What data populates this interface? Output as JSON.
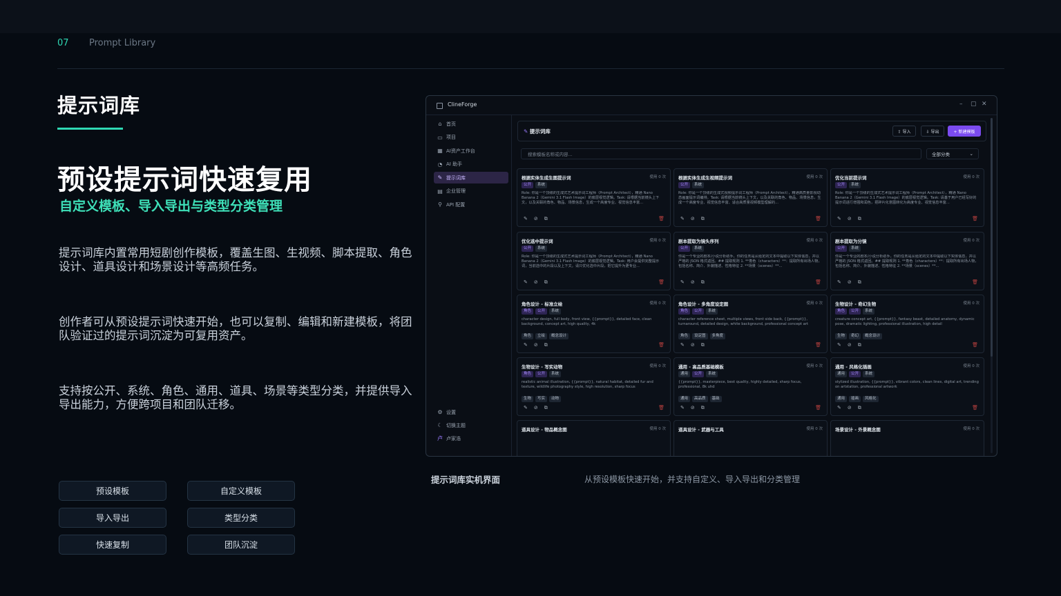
{
  "header": {
    "page_number": "07",
    "section_name": "Prompt Library"
  },
  "hero": {
    "title": "提示词库",
    "headline": "预设提示词快速复用",
    "subheadline": "自定义模板、导入导出与类型分类管理",
    "paragraphs": [
      "提示词库内置常用短剧创作模板，覆盖生图、生视频、脚本提取、角色设计、道具设计和场景设计等高频任务。",
      "创作者可从预设提示词快速开始，也可以复制、编辑和新建模板，将团队验证过的提示词沉淀为可复用资产。",
      "支持按公开、系统、角色、通用、道具、场景等类型分类，并提供导入导出能力，方便跨项目和团队迁移。"
    ]
  },
  "feature_chips": [
    "预设模板",
    "自定义模板",
    "导入导出",
    "类型分类",
    "快速复制",
    "团队沉淀"
  ],
  "captions": {
    "left": "提示词库实机界面",
    "right": "从预设模板快速开始，并支持自定义、导入导出和分类管理"
  },
  "colors": {
    "accent": "#2fd9b4",
    "brand_purple": "#7b4bf0",
    "background": "#060b12"
  },
  "app": {
    "window_title": "ClineForge",
    "window_controls": [
      "–",
      "▢",
      "✕"
    ],
    "sidebar": {
      "items": [
        {
          "label": "首页",
          "icon": "⌂",
          "icon_name": "home-icon",
          "active": false
        },
        {
          "label": "项目",
          "icon": "▭",
          "icon_name": "folder-icon",
          "active": false
        },
        {
          "label": "AI资产工作台",
          "icon": "▦",
          "icon_name": "asset-icon",
          "active": false
        },
        {
          "label": "AI 助手",
          "icon": "◔",
          "icon_name": "assistant-icon",
          "active": false
        },
        {
          "label": "提示词库",
          "icon": "✎",
          "icon_name": "prompt-library-icon",
          "active": true
        },
        {
          "label": "企业管理",
          "icon": "▤",
          "icon_name": "enterprise-icon",
          "active": false
        },
        {
          "label": "API 配置",
          "icon": "⚲",
          "icon_name": "api-icon",
          "active": false
        }
      ],
      "bottom": [
        {
          "label": "设置",
          "icon": "⚙",
          "icon_name": "gear-icon"
        },
        {
          "label": "切换主题",
          "icon": "☾",
          "icon_name": "theme-icon"
        },
        {
          "label": "卢家浩",
          "icon": "卢",
          "icon_name": "avatar"
        }
      ]
    },
    "panel_title": "提示词库",
    "buttons": {
      "import": "⇪ 导入",
      "export": "⇩ 导出",
      "new_template": "+ 新建模板"
    },
    "search_placeholder": "搜索模板名称或内容...",
    "category_select": "全部分类",
    "cards": [
      {
        "title": "根据实体生成生图提示词",
        "usage": "使用 0 次",
        "tags": [
          {
            "t": "公开",
            "c": "purple"
          },
          {
            "t": "系统",
            "c": "gray"
          }
        ],
        "desc": "Role: 你是一个顶级的生成式艺术提示词工程师（Prompt Architect），精通 Nano Banana 2（Gemini 3.1 Flash Image）的底层视觉逻辑。Task: 请根据当前镜头上下文，以及关联的角色、物品、场景信息，生成一个高度专业、视觉信息丰富...",
        "keywords": []
      },
      {
        "title": "根据实体生成生视频提示词",
        "usage": "使用 0 次",
        "tags": [
          {
            "t": "公开",
            "c": "purple"
          },
          {
            "t": "系统",
            "c": "gray"
          }
        ],
        "desc": "Role: 你是一个顶级的生成式视频提示词工程师（Prompt Architect），精通高质量影视动态画面提示词编排。Task: 请根据当前镜头上下文，以及关联的角色、物品、场景信息，生成一个高度专业、视觉信息丰富、适合高质量视频模型理解的...",
        "keywords": []
      },
      {
        "title": "优化当前提示词",
        "usage": "使用 0 次",
        "tags": [
          {
            "t": "公开",
            "c": "purple"
          },
          {
            "t": "系统",
            "c": "gray"
          }
        ],
        "desc": "Role: 你是一个顶级的生成式艺术提示词工程师（Prompt Architect），精通 Nano Banana 2（Gemini 3.1 Flash Image）的底层视觉逻辑。Task: 请基于用户已经写好的提示词进行增强和润色，把碎片化意图转化为高度专业、视觉信息丰富...",
        "keywords": []
      },
      {
        "title": "优化选中提示词",
        "usage": "使用 0 次",
        "tags": [
          {
            "t": "公开",
            "c": "purple"
          },
          {
            "t": "系统",
            "c": "gray"
          }
        ],
        "desc": "Role: 你是一个顶级的生成式艺术提示词工程师（Prompt Architect），精通 Nano Banana 2（Gemini 3.1 Flash Image）的底层视觉逻辑。Task: 用户会提供完整提示词，当前选中的片段以及上下文。请只优化选中片段，把它提升为更专业...",
        "keywords": []
      },
      {
        "title": "剧本提取为镜头序列",
        "usage": "使用 0 次",
        "tags": [
          {
            "t": "公开",
            "c": "purple"
          },
          {
            "t": "系统",
            "c": "gray"
          }
        ],
        "desc": "你是一个专业的剧本/小说分析助手。你的任务是从给定的文本中提取以下实体信息，并以严格的 JSON 格式返回。## 提取规则 1. **角色（characters）**：提取所有出场人物，包括名称、简介、外貌描述、性格特征 2. **场景（scenes）**...",
        "keywords": []
      },
      {
        "title": "剧本提取为分镜",
        "usage": "使用 0 次",
        "tags": [
          {
            "t": "公开",
            "c": "purple"
          },
          {
            "t": "系统",
            "c": "gray"
          }
        ],
        "desc": "你是一个专业的剧本/小说分析助手。你的任务是从给定的文本中提取以下实体信息，并以严格的 JSON 格式返回。## 提取规则 1. **角色（characters）**：提取所有出场人物，包括名称、简介、外貌描述、性格特征 2. **场景（scenes）**...",
        "keywords": []
      },
      {
        "title": "角色设计 - 标准立绘",
        "usage": "使用 0 次",
        "tags": [
          {
            "t": "角色",
            "c": "purple"
          },
          {
            "t": "公开",
            "c": "purple"
          },
          {
            "t": "系统",
            "c": "gray"
          }
        ],
        "desc": "character design, full body, front view, {{prompt}}, detailed face, clean background, concept art, high quality, 4k",
        "keywords": [
          "角色",
          "立绘",
          "概念设计"
        ]
      },
      {
        "title": "角色设计 - 多角度设定图",
        "usage": "使用 0 次",
        "tags": [
          {
            "t": "角色",
            "c": "purple"
          },
          {
            "t": "公开",
            "c": "purple"
          },
          {
            "t": "系统",
            "c": "gray"
          }
        ],
        "desc": "character reference sheet, multiple views, front side back, {{prompt}}, turnaround, detailed design, white background, professional concept art",
        "keywords": [
          "角色",
          "设定图",
          "多角度"
        ]
      },
      {
        "title": "生物设计 - 奇幻生物",
        "usage": "使用 0 次",
        "tags": [
          {
            "t": "角色",
            "c": "purple"
          },
          {
            "t": "公开",
            "c": "purple"
          },
          {
            "t": "系统",
            "c": "gray"
          }
        ],
        "desc": "creature concept art, {{prompt}}, fantasy beast, detailed anatomy, dynamic pose, dramatic lighting, professional illustration, high detail",
        "keywords": [
          "生物",
          "奇幻",
          "概念设计"
        ]
      },
      {
        "title": "生物设计 - 写实动物",
        "usage": "使用 0 次",
        "tags": [
          {
            "t": "角色",
            "c": "purple"
          },
          {
            "t": "公开",
            "c": "purple"
          },
          {
            "t": "系统",
            "c": "gray"
          }
        ],
        "desc": "realistic animal illustration, {{prompt}}, natural habitat, detailed fur and texture, wildlife photography style, high resolution, sharp focus",
        "keywords": [
          "生物",
          "写实",
          "动物"
        ]
      },
      {
        "title": "通用 - 高品质基础模板",
        "usage": "使用 0 次",
        "tags": [
          {
            "t": "通用",
            "c": "gray"
          },
          {
            "t": "公开",
            "c": "purple"
          },
          {
            "t": "系统",
            "c": "gray"
          }
        ],
        "desc": "{{prompt}}, masterpiece, best quality, highly detailed, sharp focus, professional, 8k uhd",
        "keywords": [
          "通用",
          "高品质",
          "基础"
        ]
      },
      {
        "title": "通用 - 风格化插画",
        "usage": "使用 0 次",
        "tags": [
          {
            "t": "通用",
            "c": "gray"
          },
          {
            "t": "公开",
            "c": "purple"
          },
          {
            "t": "系统",
            "c": "gray"
          }
        ],
        "desc": "stylized illustration, {{prompt}}, vibrant colors, clean lines, digital art, trending on artstation, professional artwork",
        "keywords": [
          "通用",
          "插画",
          "风格化"
        ]
      },
      {
        "title": "道具设计 - 物品概念图",
        "usage": "使用 0 次",
        "tags": [],
        "desc": "",
        "keywords": []
      },
      {
        "title": "道具设计 - 武器与工具",
        "usage": "使用 0 次",
        "tags": [],
        "desc": "",
        "keywords": []
      },
      {
        "title": "场景设计 - 外景概念图",
        "usage": "使用 0 次",
        "tags": [],
        "desc": "",
        "keywords": []
      }
    ]
  }
}
